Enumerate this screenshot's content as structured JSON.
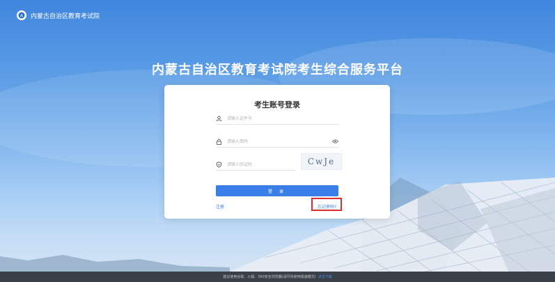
{
  "header": {
    "site_name": "内蒙古自治区教育考试院"
  },
  "main": {
    "title": "内蒙古自治区教育考试院考生综合服务平台"
  },
  "login": {
    "title": "考生账号登录",
    "id_placeholder": "请输入证件号",
    "password_placeholder": "请输入密码",
    "captcha_placeholder": "请输入验证码",
    "captcha_text": "CwJe",
    "login_label": "登 录",
    "register_label": "注册",
    "forgot_label": "忘记密码?"
  },
  "footer": {
    "text": "建议使用谷歌、火狐、360安全浏览器(请尽快使用极速模式)",
    "download_link": "点击下载"
  },
  "colors": {
    "accent": "#3a7ee7",
    "highlight": "#e02c2c",
    "footer_bg": "#3b3f47"
  }
}
